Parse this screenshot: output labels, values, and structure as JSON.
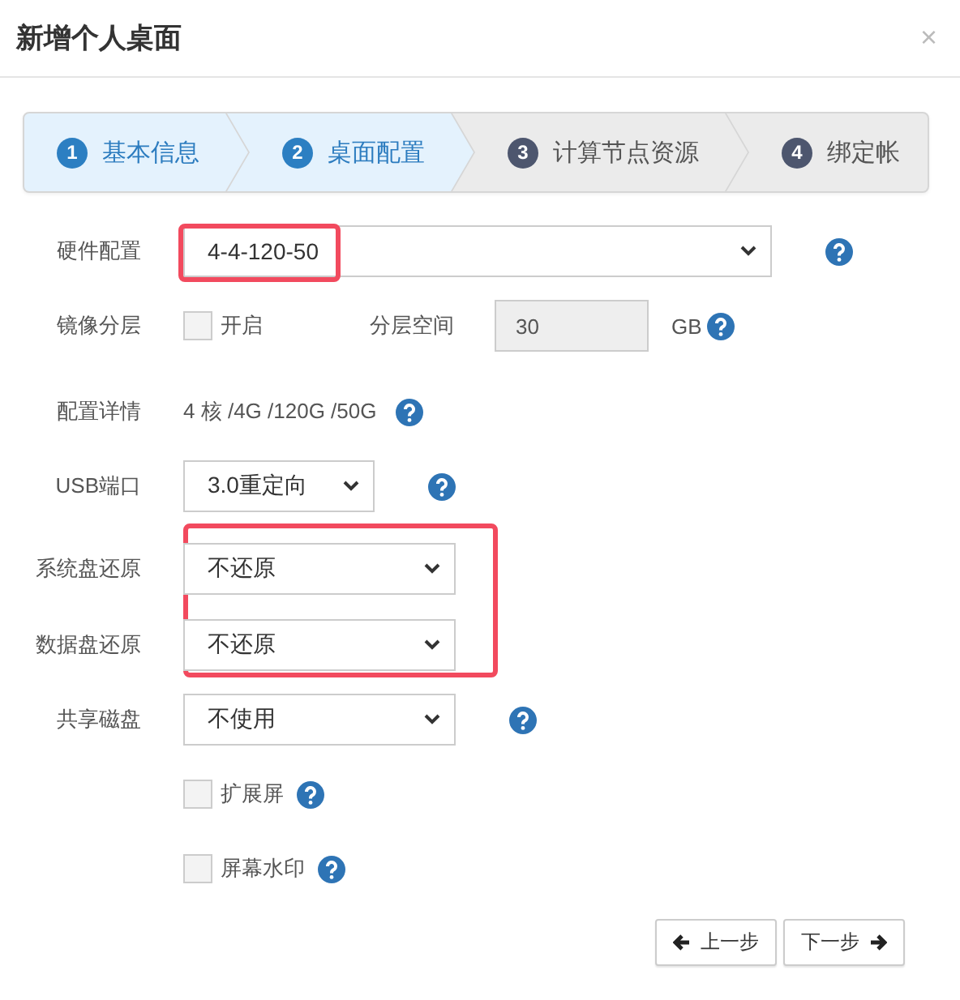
{
  "dialog": {
    "title": "新增个人桌面",
    "close": "×"
  },
  "steps": [
    {
      "number": "1",
      "label": "基本信息",
      "active": true
    },
    {
      "number": "2",
      "label": "桌面配置",
      "active": true
    },
    {
      "number": "3",
      "label": "计算节点资源",
      "active": false
    },
    {
      "number": "4",
      "label": "绑定帐",
      "active": false
    }
  ],
  "rows": [
    {
      "kind": "select",
      "label": "硬件配置",
      "value": "4-4-120-50",
      "help": true,
      "highlighted": true
    },
    {
      "kind": "layering",
      "label": "镜像分层",
      "checkbox": {
        "label": "开启",
        "checked": false
      },
      "space_label": "分层空间",
      "space_value": "30",
      "unit": "GB",
      "help": true
    },
    {
      "kind": "text",
      "label": "配置详情",
      "value": "4 核 /4G /120G /50G",
      "help": true
    },
    {
      "kind": "select",
      "label": "USB端口",
      "value": "3.0重定向",
      "help": true,
      "highlighted": false
    },
    {
      "kind": "group",
      "highlighted": true,
      "rows": [
        {
          "kind": "select",
          "label": "系统盘还原",
          "value": "不还原",
          "help": false,
          "highlighted": false
        },
        {
          "kind": "select",
          "label": "数据盘还原",
          "value": "不还原",
          "help": false,
          "highlighted": false
        }
      ]
    },
    {
      "kind": "select",
      "label": "共享磁盘",
      "value": "不使用",
      "help": true,
      "highlighted": false
    },
    {
      "kind": "checkbox",
      "label": "扩展屏",
      "checked": false,
      "help": true
    },
    {
      "kind": "checkbox",
      "label": "屏幕水印",
      "checked": false,
      "help": true
    }
  ],
  "buttons": [
    {
      "label": "上一步"
    },
    {
      "label": "下一步"
    }
  ]
}
